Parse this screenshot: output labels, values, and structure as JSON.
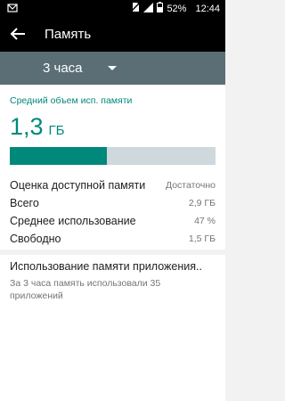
{
  "status_bar": {
    "battery": "52%",
    "time": "12:44"
  },
  "app_bar": {
    "title": "Память"
  },
  "period": {
    "selected": "3 часа"
  },
  "memory": {
    "avg_title": "Средний объем исп. памяти",
    "avg_value": "1,3",
    "avg_unit": "ГБ",
    "usage_fraction": 0.47,
    "colors": {
      "accent": "#00897b",
      "track": "#cfd8dc",
      "bar": "#5b6e76"
    },
    "stats": [
      {
        "label": "Оценка доступной памяти",
        "value": "Достаточно"
      },
      {
        "label": "Всего",
        "value": "2,9 ГБ"
      },
      {
        "label": "Среднее использование",
        "value": "47 %"
      },
      {
        "label": "Свободно",
        "value": "1,5 ГБ"
      }
    ]
  },
  "app_usage": {
    "title": "Использование памяти приложения..",
    "summary": "За 3 часа память использовали 35 приложений"
  }
}
